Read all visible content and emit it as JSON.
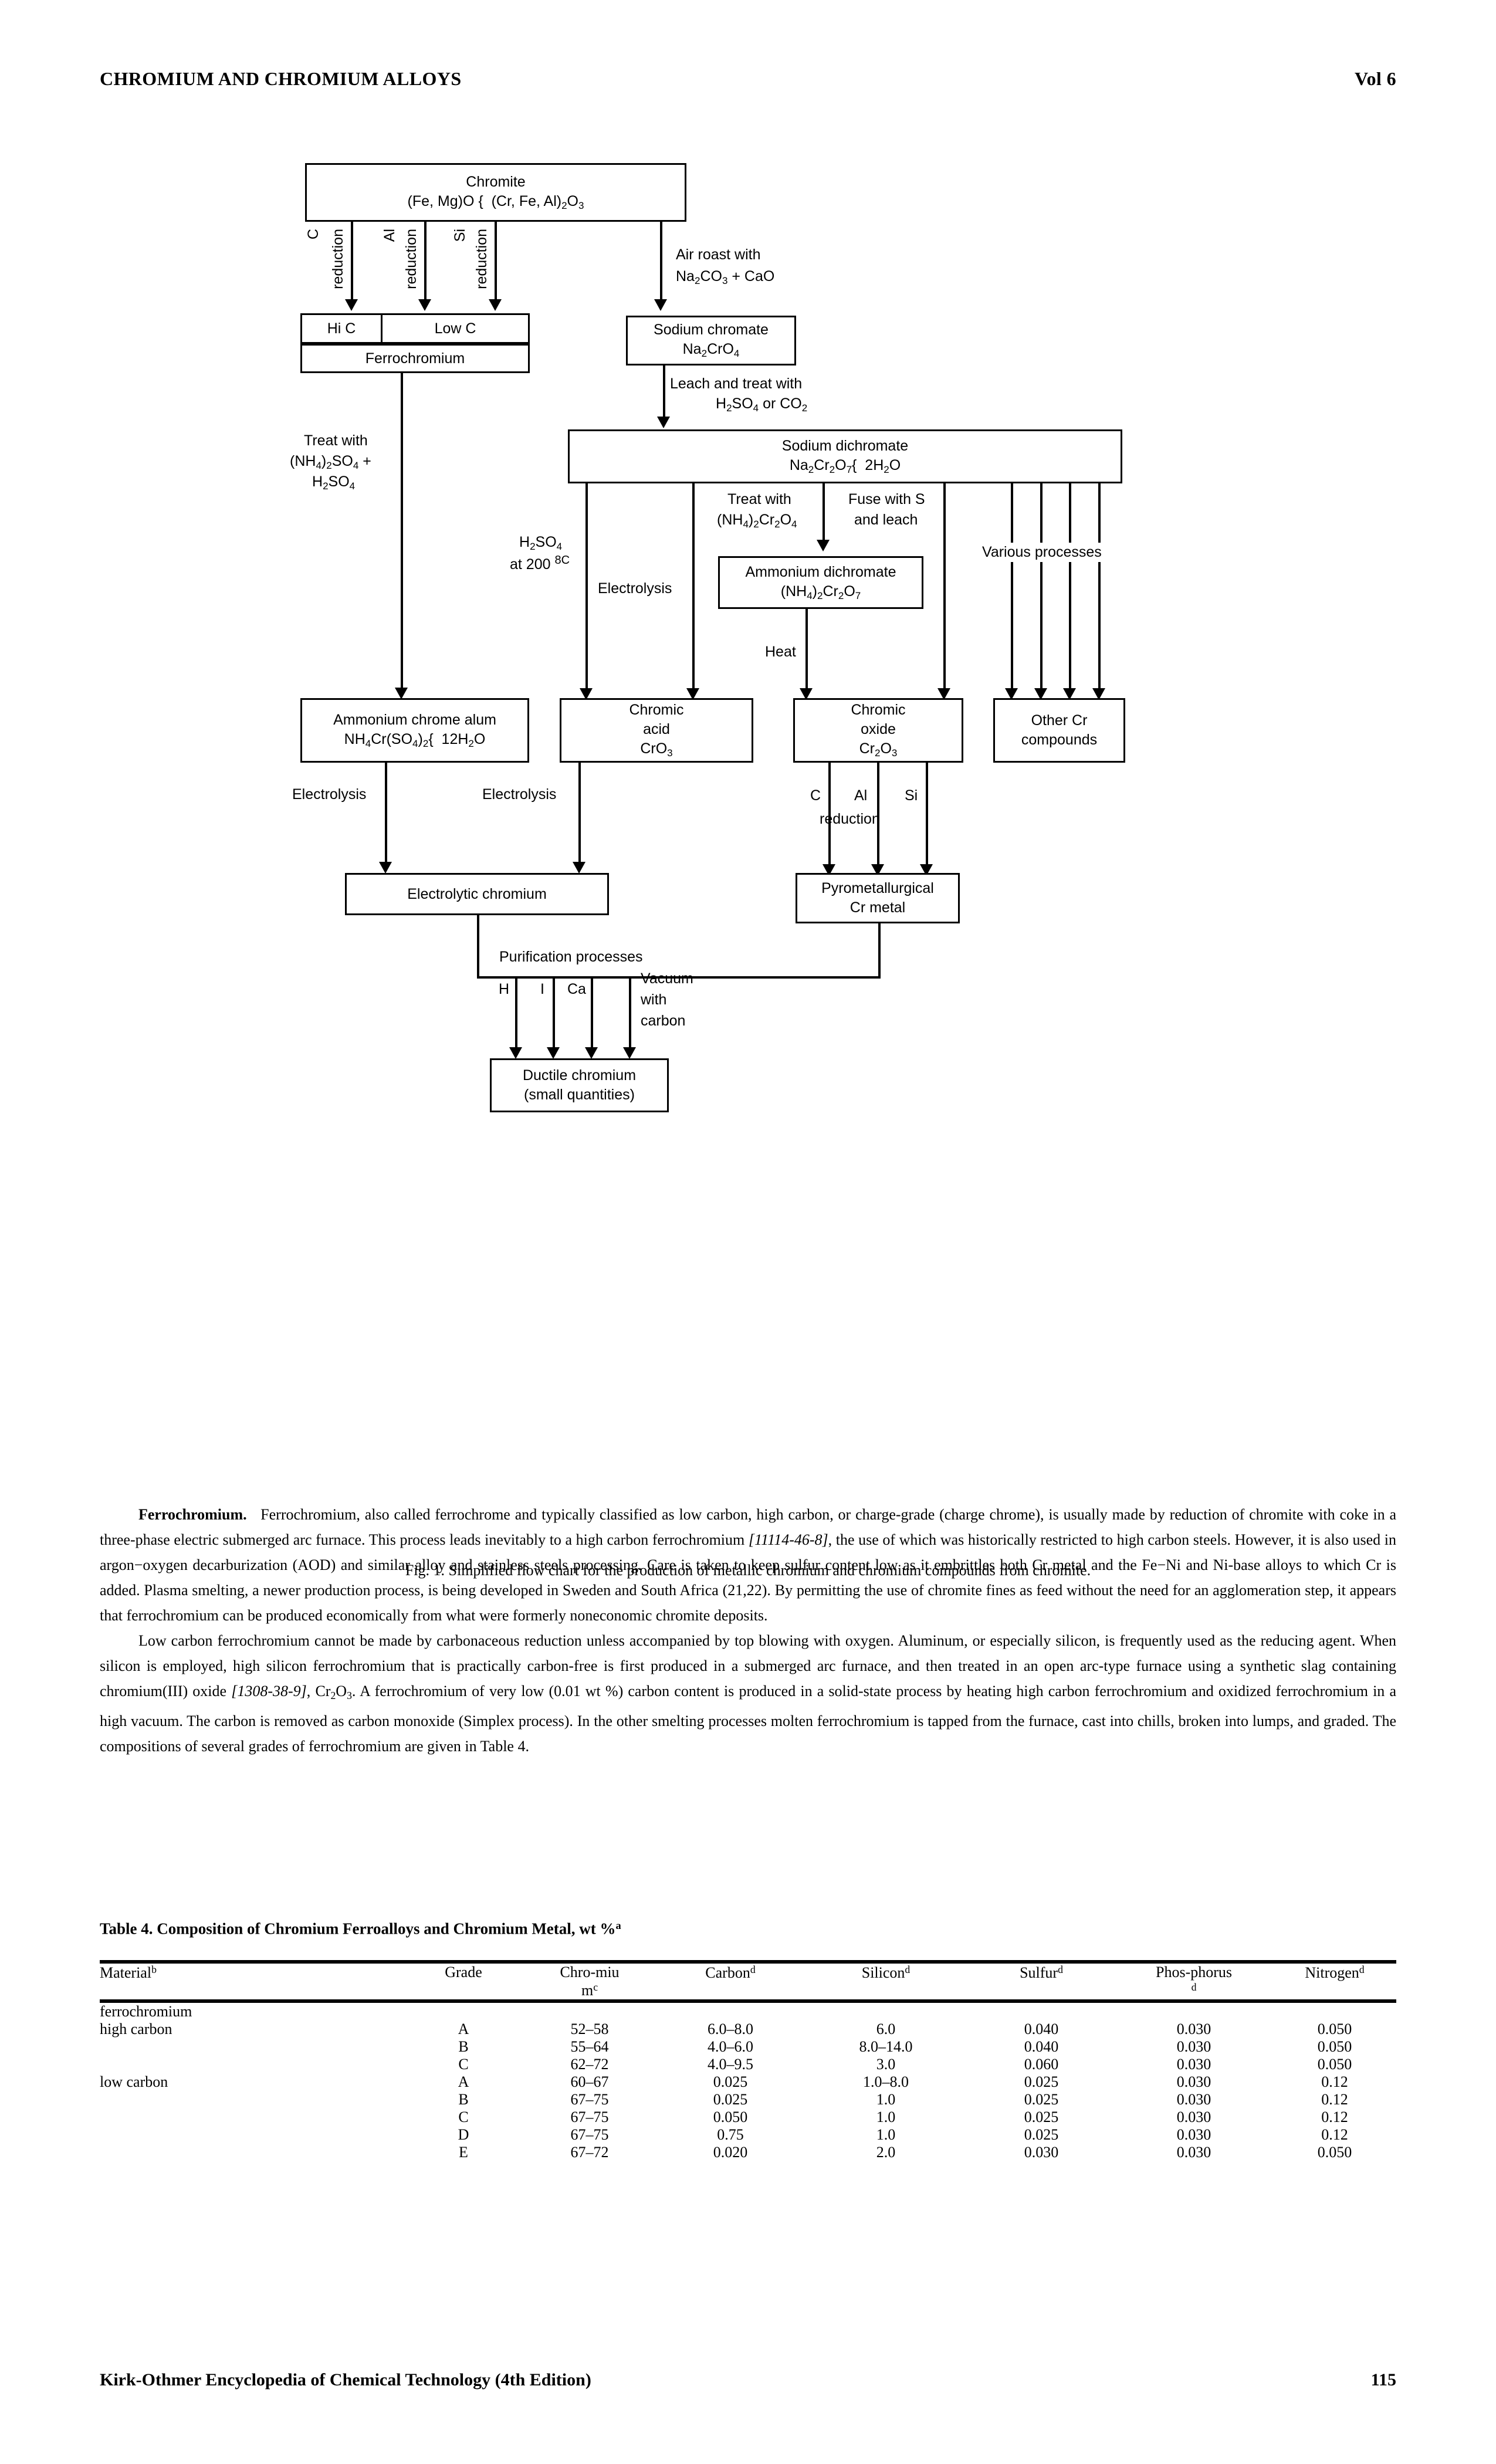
{
  "header": {
    "title": "CHROMIUM AND CHROMIUM ALLOYS",
    "volume": "Vol 6"
  },
  "figure": {
    "caption": "Fig. 1. Simplified flow chart for the production of metallic chromium and chromium compounds from chromite.",
    "nodes": {
      "chromite": {
        "line1": "Chromite",
        "line2_a": "(Fe, Mg)O {",
        "line2_b": "(Cr, Fe, Al)",
        "line2_sub": "2",
        "line2_c": "O",
        "line2_sub2": "3"
      },
      "hi_c": "Hi C",
      "low_c": "Low C",
      "ferrochromium": "Ferrochromium",
      "sodium_chromate": {
        "line1": "Sodium chromate",
        "formula": "Na2CrO4"
      },
      "sodium_dichromate": {
        "line1": "Sodium dichromate",
        "formula": "Na2Cr2O7{ 2H2O"
      },
      "ammonium_dichromate": {
        "line1": "Ammonium dichromate",
        "formula": "(NH4)2Cr2O7"
      },
      "ammonium_chrome_alum": {
        "line1": "Ammonium chrome alum",
        "formula": "NH4Cr(SO4)2{ 12H2O"
      },
      "chromic_acid": {
        "line1": "Chromic",
        "line2": "acid",
        "formula": "CrO3"
      },
      "chromic_oxide": {
        "line1": "Chromic",
        "line2": "oxide",
        "formula": "Cr2O3"
      },
      "other_cr": {
        "line1": "Other Cr",
        "line2": "compounds"
      },
      "electrolytic_chromium": "Electrolytic chromium",
      "pyrometallurgical": {
        "line1": "Pyrometallurgical",
        "line2": "Cr metal"
      },
      "ductile_chromium": {
        "line1": "Ductile chromium",
        "line2": "(small quantities)"
      }
    },
    "edge_labels": {
      "c_reduction_a": "C",
      "c_reduction_b": "reduction",
      "al_reduction_a": "Al",
      "al_reduction_b": "reduction",
      "si_reduction_a": "Si",
      "si_reduction_b": "reduction",
      "air_roast_1": "Air roast with",
      "air_roast_2": "Na2CO3 + CaO",
      "leach_1": "Leach and treat with",
      "leach_2": "H2SO4 or CO2",
      "treat_sulf_1": "Treat with",
      "treat_sulf_2": "(NH4)2SO4 +",
      "treat_sulf_3": "H2SO4",
      "h2so4_1": "H2SO4",
      "h2so4_2": "at 200 8C",
      "electrolysis_mid": "Electrolysis",
      "treat_nh4_1": "Treat with",
      "treat_nh4_2": "(NH4)2Cr2O4",
      "fuse_1": "Fuse with S",
      "fuse_2": "and leach",
      "various": "Various processes",
      "heat": "Heat",
      "electrolysis_left": "Electrolysis",
      "electrolysis_left2": "Electrolysis",
      "c_red2": "C",
      "al_red2": "Al",
      "si_red2": "Si",
      "reduction2": "reduction",
      "purification": "Purification processes",
      "pur_h": "H",
      "pur_i": "I",
      "pur_ca": "Ca",
      "pur_vac_1": "Vacuum",
      "pur_vac_2": "with",
      "pur_vac_3": "carbon"
    }
  },
  "body": {
    "p1_head": "Ferrochromium.",
    "p1_a": "Ferrochromium, also called ferrochrome and typically classified as low carbon, high carbon, or charge-grade (charge chrome), is usually made by reduction of chromite with coke in a three-phase electric submerged arc furnace. This process leads inevitably to a high carbon ferrochromium ",
    "p1_cite": "[11114-46-8]",
    "p1_b": ", the use of which was historically restricted to high carbon steels. However, it is also used in argon−oxygen decarburization (AOD) and similar alloy and stainless steels processing. Care is taken to keep sulfur content low as it embrittles both Cr metal and the Fe−Ni and Ni-base alloys to which Cr is added. Plasma smelting, a newer production process, is being developed in Sweden and South Africa (21,22). By permitting the use of chromite fines as feed without the need for an agglomeration step, it appears that ferrochromium can be produced economically from what were formerly noneconomic chromite deposits.",
    "p2_a": "Low carbon ferrochromium cannot be made by carbonaceous reduction unless accompanied by top blowing with oxygen. Aluminum, or especially silicon, is frequently used as the reducing agent. When silicon is employed, high silicon ferrochromium that is practically carbon-free is first produced in a submerged arc furnace, and then treated in an open arc-type furnace using a synthetic slag containing chromium(III) oxide ",
    "p2_cite": "[1308-38-9]",
    "p2_b": ", Cr",
    "p2_sub1": "2",
    "p2_c": "O",
    "p2_sub2": "3",
    "p2_d": ". A ferrochromium of very low (0.01 wt %) carbon content is produced in a solid-state process by heating high carbon ferrochromium and oxidized ferrochromium in a high vacuum. The carbon is removed as carbon monoxide (Simplex process). In the other smelting processes molten ferrochromium is tapped from the furnace, cast into chills, broken into lumps, and graded. The compositions of several grades of ferrochromium are given in Table 4."
  },
  "table": {
    "caption_main": "Table 4. Composition of Chromium Ferroalloys and Chromium Metal, wt %",
    "caption_sup": "a",
    "columns": [
      {
        "label": "Material",
        "sup": "b"
      },
      {
        "label": "Grade",
        "sup": ""
      },
      {
        "label": "Chro-miu",
        "label2": "m",
        "sup": "c"
      },
      {
        "label": "Carbon",
        "sup": "d"
      },
      {
        "label": "Silicon",
        "sup": "d"
      },
      {
        "label": "Sulfur",
        "sup": "d"
      },
      {
        "label": "Phos-phorus",
        "sup": "d"
      },
      {
        "label": "Nitrogen",
        "sup": "d"
      }
    ],
    "group_row": "ferrochromium",
    "rows": [
      {
        "material": "high carbon",
        "grade": "A",
        "chromium": "52–58",
        "carbon": "6.0–8.0",
        "silicon": "6.0",
        "sulfur": "0.040",
        "phosphorus": "0.030",
        "nitrogen": "0.050"
      },
      {
        "material": "",
        "grade": "B",
        "chromium": "55–64",
        "carbon": "4.0–6.0",
        "silicon": "8.0–14.0",
        "sulfur": "0.040",
        "phosphorus": "0.030",
        "nitrogen": "0.050"
      },
      {
        "material": "",
        "grade": "C",
        "chromium": "62–72",
        "carbon": "4.0–9.5",
        "silicon": "3.0",
        "sulfur": "0.060",
        "phosphorus": "0.030",
        "nitrogen": "0.050"
      },
      {
        "material": "low carbon",
        "grade": "A",
        "chromium": "60–67",
        "carbon": "0.025",
        "silicon": "1.0–8.0",
        "sulfur": "0.025",
        "phosphorus": "0.030",
        "nitrogen": "0.12"
      },
      {
        "material": "",
        "grade": "B",
        "chromium": "67–75",
        "carbon": "0.025",
        "silicon": "1.0",
        "sulfur": "0.025",
        "phosphorus": "0.030",
        "nitrogen": "0.12"
      },
      {
        "material": "",
        "grade": "C",
        "chromium": "67–75",
        "carbon": "0.050",
        "silicon": "1.0",
        "sulfur": "0.025",
        "phosphorus": "0.030",
        "nitrogen": "0.12"
      },
      {
        "material": "",
        "grade": "D",
        "chromium": "67–75",
        "carbon": "0.75",
        "silicon": "1.0",
        "sulfur": "0.025",
        "phosphorus": "0.030",
        "nitrogen": "0.12"
      },
      {
        "material": "",
        "grade": "E",
        "chromium": "67–72",
        "carbon": "0.020",
        "silicon": "2.0",
        "sulfur": "0.030",
        "phosphorus": "0.030",
        "nitrogen": "0.050"
      }
    ]
  },
  "footer": {
    "source": "Kirk-Othmer Encyclopedia of Chemical Technology (4th Edition)",
    "page": "115"
  }
}
